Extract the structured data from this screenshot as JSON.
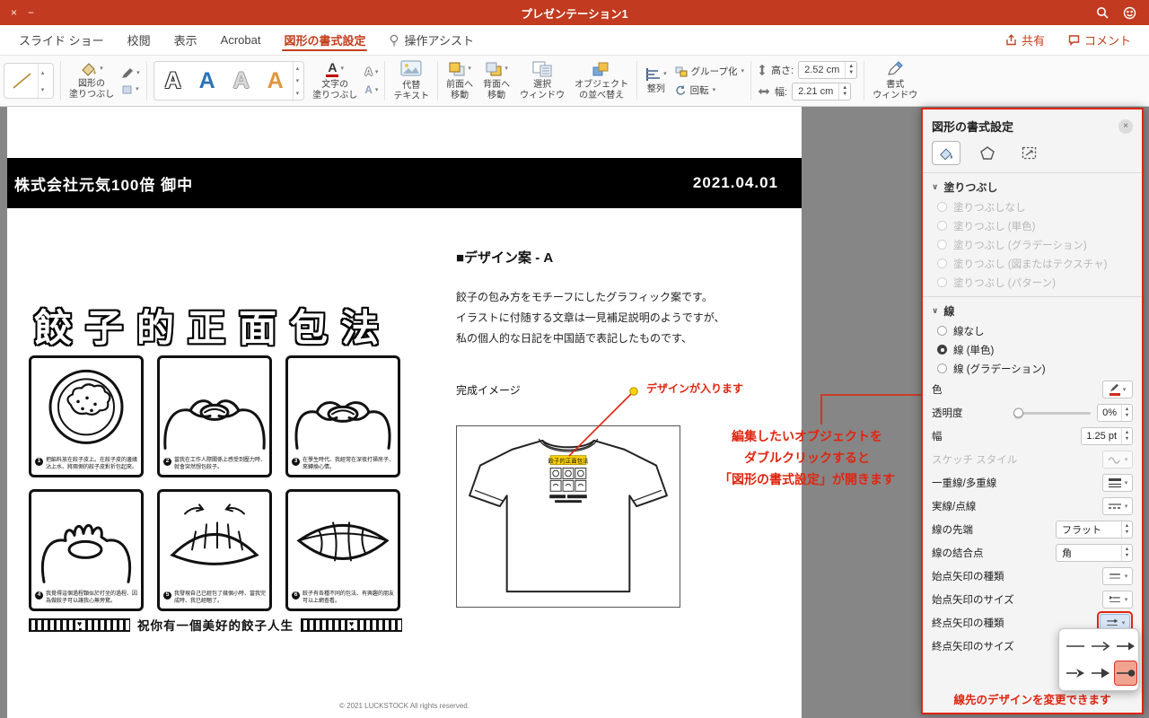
{
  "titlebar": {
    "title": "プレゼンテーション1"
  },
  "menubar": {
    "tabs": [
      {
        "label": "スライド ショー"
      },
      {
        "label": "校閲"
      },
      {
        "label": "表示"
      },
      {
        "label": "Acrobat"
      },
      {
        "label": "図形の書式設定"
      },
      {
        "label": "操作アシスト"
      }
    ],
    "share": "共有",
    "comment": "コメント"
  },
  "ribbon": {
    "shape_fill": [
      "図形の",
      "塗りつぶし"
    ],
    "text_fill": [
      "文字の",
      "塗りつぶし"
    ],
    "alt_text": [
      "代替",
      "テキスト"
    ],
    "bring_forward": [
      "前面へ",
      "移動"
    ],
    "send_backward": [
      "背面へ",
      "移動"
    ],
    "selection_pane": [
      "選択",
      "ウィンドウ"
    ],
    "reorder": [
      "オブジェクト",
      "の並べ替え"
    ],
    "align": "整列",
    "group": "グループ化",
    "rotate": "回転",
    "height_label": "高さ:",
    "height_value": "2.52 cm",
    "width_label": "幅:",
    "width_value": "2.21 cm",
    "format_pane": [
      "書式",
      "ウィンドウ"
    ]
  },
  "slide": {
    "banner": {
      "left": "株式会社元気100倍 御中",
      "right": "2021.04.01"
    },
    "poster": {
      "title": "餃子的正面包法",
      "steps": [
        {
          "num": "1",
          "caption": "把餡料放在餃子皮上。在餃子皮的邊緣沾上水、將兩側的餃子皮對折包起來。"
        },
        {
          "num": "2",
          "caption": "當我在工作人際關係上感受到壓力時、就會突然想包餃子。"
        },
        {
          "num": "3",
          "caption": "在學生時代、我經常在深夜打掃房子、來轉換心情。"
        },
        {
          "num": "4",
          "caption": "我覺得這個過程類似於打坐的過程、因為做餃子可以讓我心無旁騖。"
        },
        {
          "num": "5",
          "caption": "我發現自己已經包了幾個小時、當我完成時、我已經睏了。"
        },
        {
          "num": "6",
          "caption": "餃子有各種不同的包法、有興趣的朋友可以上網查看。"
        }
      ],
      "footer": "祝你有一個美好的餃子人生"
    },
    "design": {
      "heading": "■デザイン案 - A",
      "body": [
        "餃子の包み方をモチーフにしたグラフィック案です。",
        "イラストに付随する文章は一見補足説明のようですが、",
        "私の個人的な日記を中国語で表記したものです、"
      ],
      "finished_label": "完成イメージ",
      "callout": "デザインが入ります",
      "tshirt_title": "餃子的正面包法"
    },
    "copyright": "© 2021 LUCKSTOCK All rights reserved."
  },
  "annotations": {
    "instruction": [
      "編集したいオブジェクトを",
      "ダブルクリックすると",
      "「図形の書式設定」が開きます"
    ]
  },
  "panel": {
    "title": "図形の書式設定",
    "fill_section": "塗りつぶし",
    "fill_options": [
      "塗りつぶしなし",
      "塗りつぶし (単色)",
      "塗りつぶし (グラデーション)",
      "塗りつぶし (図またはテクスチャ)",
      "塗りつぶし (パターン)"
    ],
    "line_section": "線",
    "line_options": [
      "線なし",
      "線 (単色)",
      "線 (グラデーション)"
    ],
    "rows": {
      "color": "色",
      "transparency": "透明度",
      "transparency_value": "0%",
      "width": "幅",
      "width_value": "1.25 pt",
      "sketch": "スケッチ スタイル",
      "compound": "一重線/多重線",
      "dash": "実線/点線",
      "cap": "線の先端",
      "cap_value": "フラット",
      "join": "線の結合点",
      "join_value": "角",
      "begin_type": "始点矢印の種類",
      "begin_size": "始点矢印のサイズ",
      "end_type": "終点矢印の種類",
      "end_size": "終点矢印のサイズ"
    },
    "note": "線先のデザインを変更できます"
  },
  "icons": {
    "window-close": "x-glyph",
    "window-minimize": "minus-glyph",
    "search": "magnifier",
    "feedback": "smiley-face",
    "assist": "lightbulb",
    "share": "box-arrow-up",
    "comment": "speech-bubble",
    "shape-fill": "paint-bucket",
    "shape-outline": "pen",
    "wordart": "letter-A-gallery",
    "alt-text": "picture",
    "bring-forward": "overlapping-squares-front",
    "send-backward": "overlapping-squares-back",
    "selection-pane": "window-with-list",
    "reorder-objects": "stacked-colored-squares",
    "align": "aligned-bars",
    "group": "grouped-squares",
    "rotate": "circular-arrow",
    "height": "vertical-arrows",
    "width": "horizontal-arrows",
    "format-pane": "brush",
    "pane-close": "circle-x",
    "pane-tab-fill": "paint-bucket",
    "pane-tab-effects": "pentagon",
    "pane-tab-size": "size-handles",
    "color-picker": "pen-with-red-bar",
    "sketch-style": "squiggle",
    "compound-line": "stacked-lines",
    "dash-line": "dashed-line",
    "arrow-options": "arrowhead-gallery"
  },
  "colors": {
    "titlebar": "#c23a1f",
    "accent": "#c43e1c",
    "annotation_red": "#e0250f",
    "banner_black": "#000000",
    "highlight_yellow": "#ffd400",
    "flyout_selected_bg": "#f0a38e",
    "canvas_gray": "#868686"
  }
}
